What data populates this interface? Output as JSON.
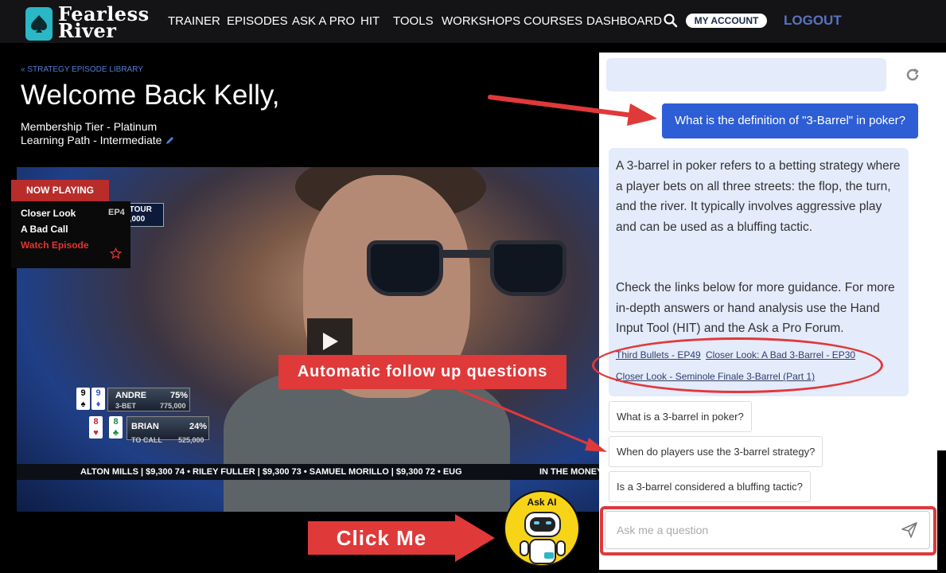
{
  "brand": {
    "line1": "Fearless",
    "line2": "River",
    "color": "#2ab7c6"
  },
  "nav": {
    "items": [
      "TRAINER",
      "EPISODES",
      "ASK A PRO",
      "HIT",
      "TOOLS",
      "WORKSHOPS",
      "COURSES",
      "DASHBOARD"
    ],
    "account_label": "MY ACCOUNT",
    "logout_label": "LOGOUT"
  },
  "page": {
    "breadcrumb": "« STRATEGY EPISODE LIBRARY",
    "welcome": "Welcome Back Kelly,",
    "tier": "Membership Tier - Platinum",
    "path": "Learning Path - Intermediate"
  },
  "now_playing": {
    "badge": "NOW PLAYING",
    "title": "Closer Look",
    "episode": "EP4",
    "subtitle": "A Bad Call",
    "watch": "Watch Episode"
  },
  "video": {
    "tour_tag_line1": "ER TOUR",
    "tour_tag_line2": "395,000",
    "players": [
      {
        "cards": [
          "9",
          "9"
        ],
        "name": "ANDRE",
        "pct": "75%",
        "action": "3-BET",
        "amount": "775,000"
      },
      {
        "cards": [
          "8",
          "8"
        ],
        "name": "BRIAN",
        "pct": "24%",
        "action": "TO CALL",
        "amount": "525,000"
      }
    ],
    "ticker": "ALTON MILLS | $9,300     74 • RILEY FULLER | $9,300     73 • SAMUEL MORILLO | $9,300     72 • EUG",
    "ticker_end": "IN THE MONEY"
  },
  "chat": {
    "user_message": "What is the definition of \"3-Barrel\" in poker?",
    "bot_answer_p1": "A 3-barrel in poker refers to a betting strategy where a player bets on all three streets: the flop, the turn, and the river. It typically involves aggressive play and can be used as a bluffing tactic.",
    "bot_answer_p2": "Check the links below for more guidance. For more in-depth answers or hand analysis use the Hand Input Tool (HIT) and the Ask a Pro Forum.",
    "links": [
      "Third Bullets - EP49",
      "Closer Look: A Bad 3-Barrel - EP30",
      "Closer Look - Seminole Finale 3-Barrel (Part 1)"
    ],
    "followups": [
      "What is a 3-barrel in poker?",
      "When do players use the 3-barrel strategy?",
      "Is a 3-barrel considered a bluffing tactic?"
    ],
    "input_placeholder": "Ask me a question"
  },
  "annotations": {
    "auto_followup": "Automatic follow up questions",
    "click_me": "Click Me",
    "ask_ai": "Ask AI",
    "color": "#e0393a"
  }
}
